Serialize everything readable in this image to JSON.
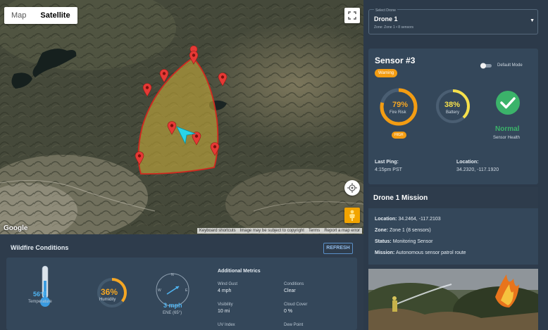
{
  "map": {
    "toggle": {
      "map_label": "Map",
      "satellite_label": "Satellite",
      "active": "Satellite"
    },
    "attribution": [
      "Keyboard shortcuts",
      "Image may be subject to copyright",
      "Terms",
      "Report a map error"
    ],
    "logo_text": "Google"
  },
  "wildfire": {
    "title": "Wildfire Conditions",
    "refresh_label": "REFRESH",
    "temperature": {
      "value": "56°F",
      "label": "Temperature"
    },
    "humidity": {
      "value": "36%",
      "label": "Humidity",
      "percent": 36
    },
    "wind": {
      "value": "3 mph",
      "direction": "ENE (65°)",
      "compass": {
        "n": "N",
        "w": "W",
        "e": "E"
      }
    },
    "additional": {
      "title": "Additional Metrics",
      "items": [
        {
          "label": "Wind Gust",
          "value": "4 mph"
        },
        {
          "label": "Conditions",
          "value": "Clear"
        },
        {
          "label": "Visibility",
          "value": "10 mi"
        },
        {
          "label": "Cloud Cover",
          "value": "0 %"
        },
        {
          "label": "UV Index",
          "value": ""
        },
        {
          "label": "Dew Point",
          "value": ""
        }
      ]
    }
  },
  "drone_select": {
    "label": "Select Drone",
    "value": "Drone 1",
    "subtitle": "Zone: Zone 1 • 8 sensors"
  },
  "sensor": {
    "title": "Sensor #3",
    "status_badge": "Warning",
    "toggle_label": "Default Mode",
    "fire_risk": {
      "value": "79%",
      "label": "Fire Risk",
      "percent": 79,
      "badge": "HIGH"
    },
    "battery": {
      "value": "38%",
      "label": "Battery",
      "percent": 38
    },
    "health": {
      "value": "Normal",
      "label": "Sensor Health"
    },
    "last_ping": {
      "label": "Last Ping:",
      "value": "4:15pm PST"
    },
    "location": {
      "label": "Location:",
      "value": "34.2320, -117.1920"
    }
  },
  "mission": {
    "title": "Drone 1 Mission",
    "rows": [
      {
        "label": "Location:",
        "value": "34.2464, -117.2103"
      },
      {
        "label": "Zone:",
        "value": "Zone 1 (8 sensors)"
      },
      {
        "label": "Status:",
        "value": "Monitoring Sensor"
      },
      {
        "label": "Mission:",
        "value": "Autonomous sensor patrol route"
      }
    ]
  },
  "colors": {
    "warning": "#f39c12",
    "battery": "#f6e04b",
    "health": "#3bb36a",
    "info_blue": "#4fb3f0",
    "zone_stroke": "#d0281f"
  }
}
